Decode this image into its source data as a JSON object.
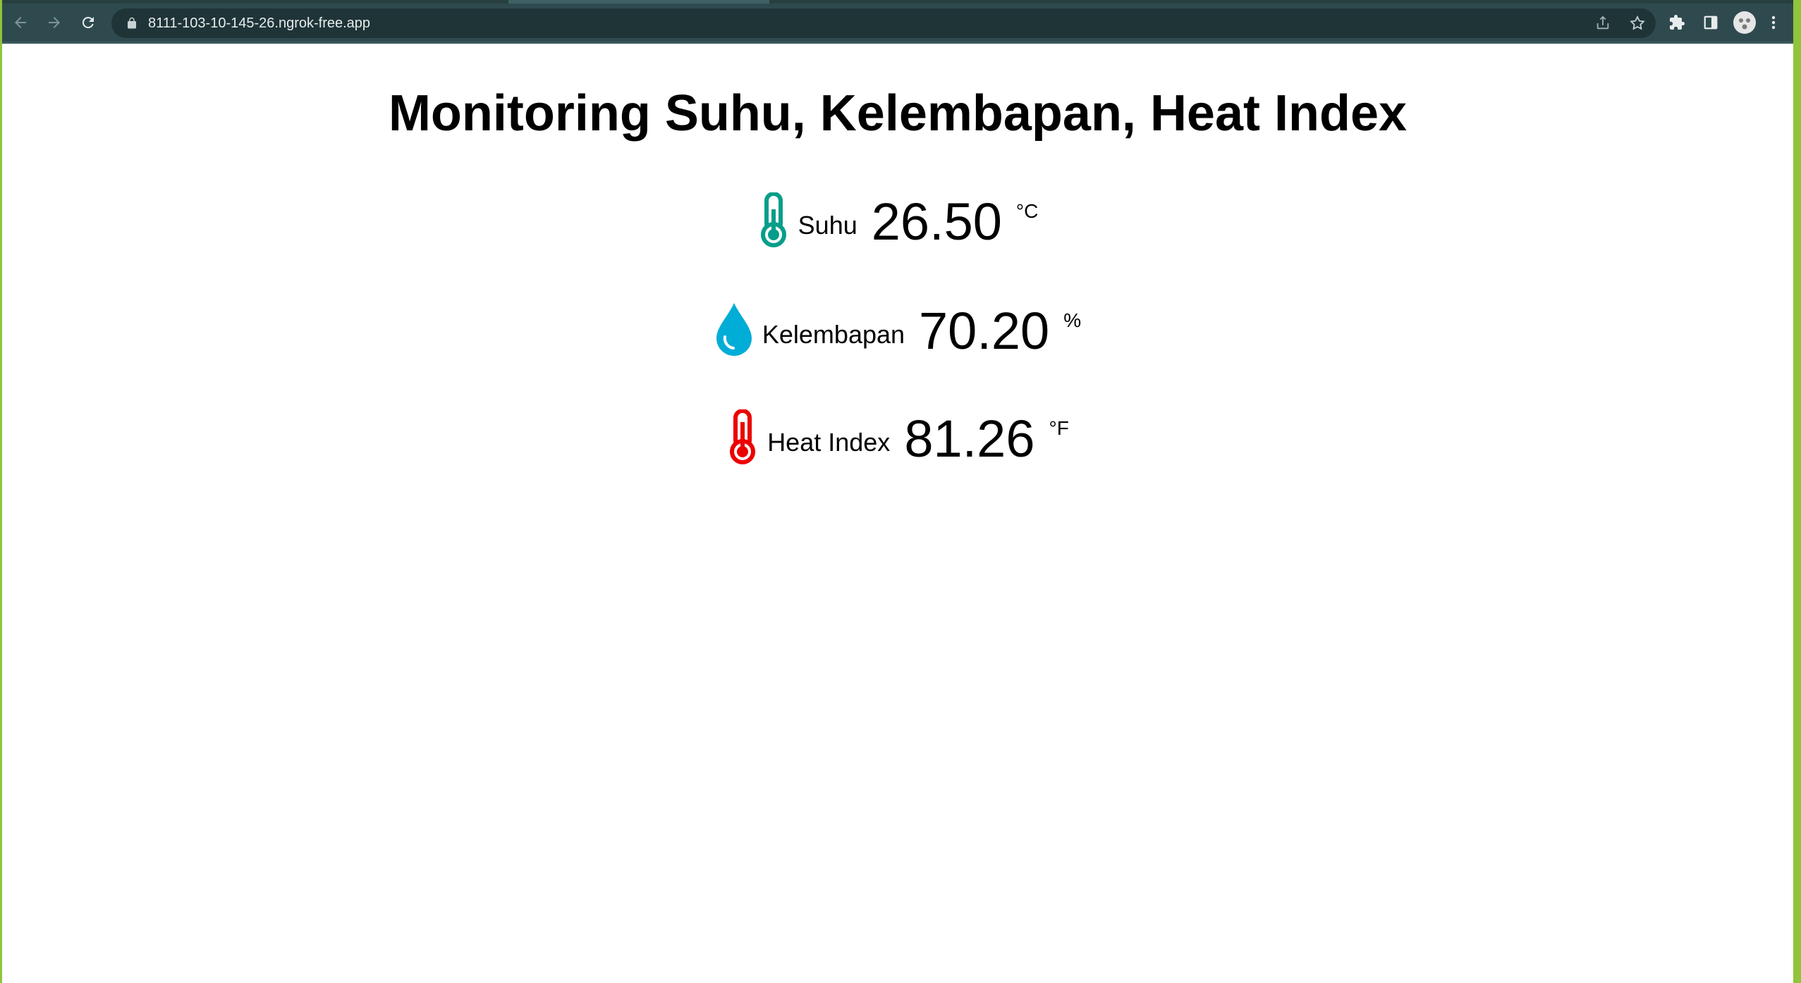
{
  "browser": {
    "url": "8111-103-10-145-26.ngrok-free.app"
  },
  "page": {
    "title": "Monitoring Suhu, Kelembapan, Heat Index",
    "readings": [
      {
        "icon": "thermometer-icon",
        "label": "Suhu",
        "value": "26.50",
        "unit": "°C",
        "color": "#059e8a"
      },
      {
        "icon": "water-drop-icon",
        "label": "Kelembapan",
        "value": "70.20",
        "unit": "%",
        "color": "#00add6"
      },
      {
        "icon": "thermometer-icon",
        "label": "Heat Index",
        "value": "81.26",
        "unit": "°F",
        "color": "#ec0000"
      }
    ]
  }
}
